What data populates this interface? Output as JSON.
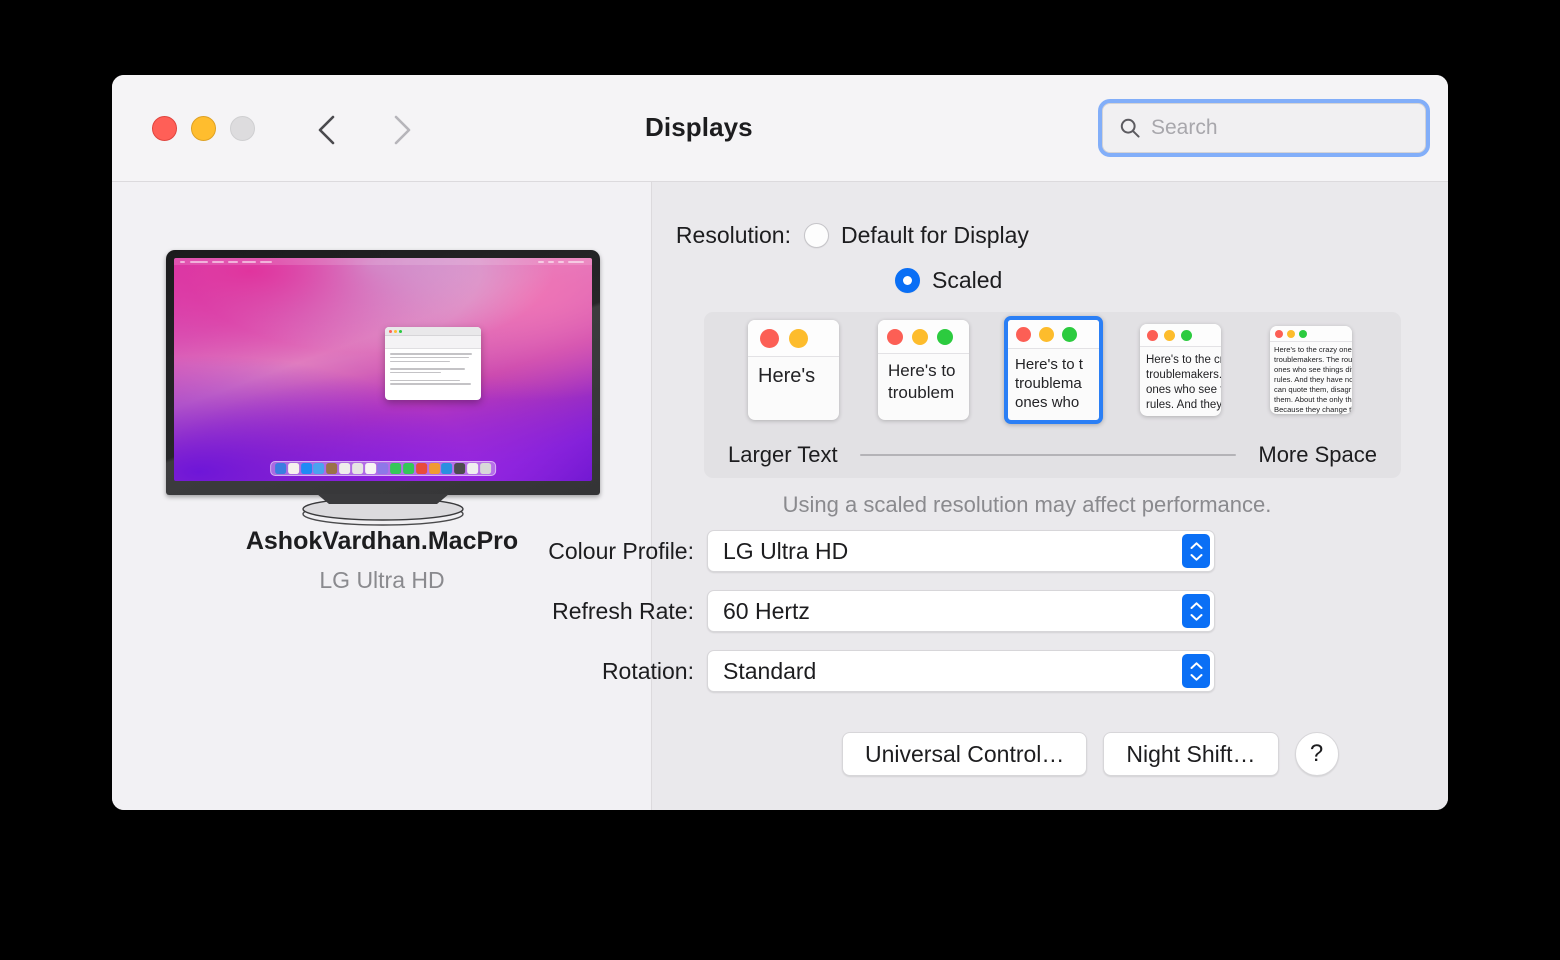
{
  "window": {
    "title": "Displays",
    "traffic_lights": [
      "close",
      "minimise",
      "zoom"
    ],
    "nav": {
      "back": "back-chevron",
      "forward": "forward-chevron"
    },
    "grid_icon": "show-all-grid-icon"
  },
  "search": {
    "placeholder": "Search",
    "value": "",
    "icon": "search-icon"
  },
  "sidebar": {
    "display_name": "AshokVardhan.MacPro",
    "display_model": "LG Ultra HD",
    "preview": {
      "wallpaper": "macOS Monterey pink purple swirl",
      "window_title": "Here's to the crazy ones",
      "dock_icon_colors": [
        "#3b7de0",
        "#f4f2f0",
        "#1f8af5",
        "#4aa3ef",
        "#9a7248",
        "#e9e8e6",
        "#e0e0e0",
        "#f2f1ef",
        "#5ac8fa",
        "#35c759",
        "#34c759",
        "#e84b3c",
        "#f09a32",
        "#2b8fe0",
        "#4c4c4e",
        "#efefef",
        "#d8d8d8"
      ]
    }
  },
  "main": {
    "resolution": {
      "label": "Resolution:",
      "options": [
        {
          "label": "Default for Display",
          "selected": false
        },
        {
          "label": "Scaled",
          "selected": true
        }
      ]
    },
    "scaling": {
      "selected_index": 2,
      "thumbnails": [
        {
          "text": "Here's",
          "lights": 2
        },
        {
          "text": "Here's to\ntroublem",
          "lights": 3
        },
        {
          "text": "Here's to t\ntroublema\nones who",
          "lights": 3
        },
        {
          "text": "Here's to the cr\ntroublemakers.\nones who see t\nrules. And they",
          "lights": 3
        },
        {
          "text": "Here's to the crazy one\ntroublemakers. The rou\nones who see things dif\nrules. And they have no\ncan quote them, disagr\nthem. About the only th\nBecause they change th",
          "lights": 3
        }
      ],
      "left_label": "Larger Text",
      "right_label": "More Space",
      "note": "Using a scaled resolution may affect performance."
    },
    "popups": [
      {
        "label": "Colour Profile:",
        "value": "LG Ultra HD"
      },
      {
        "label": "Refresh Rate:",
        "value": "60 Hertz"
      },
      {
        "label": "Rotation:",
        "value": "Standard"
      }
    ],
    "buttons": {
      "universal_control": "Universal Control…",
      "night_shift": "Night Shift…",
      "help": "?"
    }
  },
  "colors": {
    "accent": "#0a6ff5",
    "selection_border": "#2b7ff5",
    "focus_ring": "#82aef9",
    "close": "#ff5f57",
    "minimise": "#ffbd2e",
    "zoom_disabled": "#dddcde"
  }
}
